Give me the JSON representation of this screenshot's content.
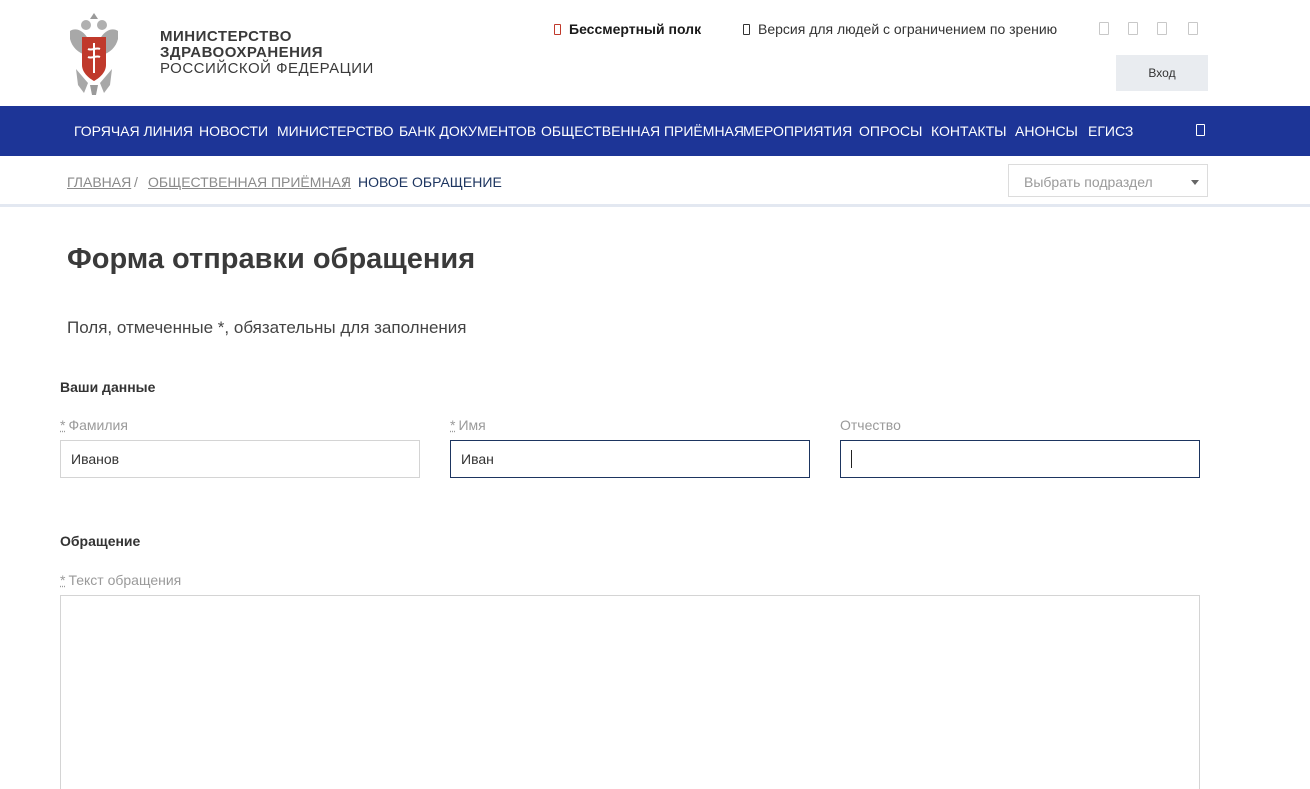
{
  "header": {
    "ministry_line1": "МИНИСТЕРСТВО",
    "ministry_line2": "ЗДРАВООХРАНЕНИЯ",
    "ministry_line3": "РОССИЙСКОЙ ФЕДЕРАЦИИ",
    "polk_link": "Бессмертный полк",
    "vision_link": "Версия для людей с ограничением по зрению",
    "login_label": "Вход"
  },
  "nav": {
    "items": [
      {
        "label": "ГОРЯЧАЯ ЛИНИЯ"
      },
      {
        "label": "НОВОСТИ"
      },
      {
        "label": "МИНИСТЕРСТВО"
      },
      {
        "label": "БАНК ДОКУМЕНТОВ"
      },
      {
        "label": "ОБЩЕСТВЕННАЯ ПРИЁМНАЯ"
      },
      {
        "label": "МЕРОПРИЯТИЯ"
      },
      {
        "label": "ОПРОСЫ"
      },
      {
        "label": "КОНТАКТЫ"
      },
      {
        "label": "АНОНСЫ"
      },
      {
        "label": "ЕГИСЗ"
      }
    ]
  },
  "breadcrumb": {
    "home": "ГЛАВНАЯ",
    "reception": "ОБЩЕСТВЕННАЯ ПРИЁМНАЯ",
    "current": "НОВОЕ ОБРАЩЕНИЕ",
    "separator": "/",
    "select_placeholder": "Выбрать подраздел"
  },
  "form": {
    "title": "Форма отправки обращения",
    "hint": "Поля, отмеченные *, обязательны для заполнения",
    "section_personal": "Ваши данные",
    "required_mark": "*",
    "surname_label": "Фамилия",
    "surname_value": "Иванов",
    "name_label": "Имя",
    "name_value": "Иван",
    "patronymic_label": "Отчество",
    "patronymic_value": "",
    "section_appeal": "Обращение",
    "appeal_label": "Текст обращения",
    "appeal_value": ""
  },
  "colors": {
    "nav_bg": "#1d3597",
    "accent_dark": "#1d3560",
    "polk_red": "#c0392b"
  }
}
